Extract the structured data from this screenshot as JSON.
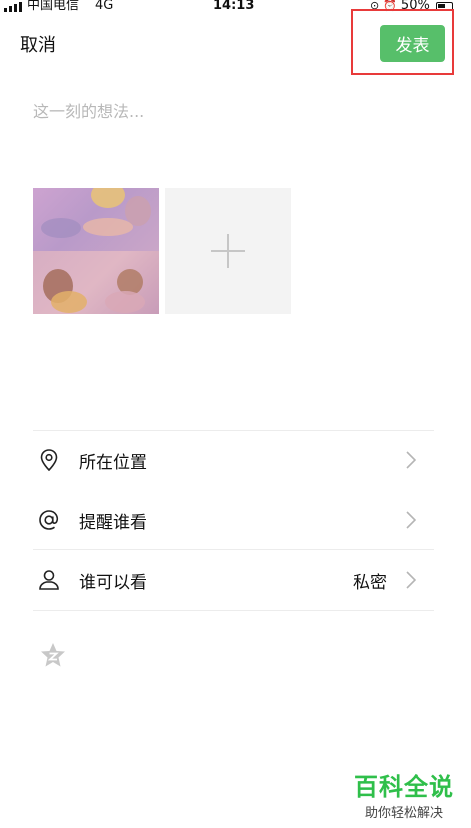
{
  "status_bar": {
    "carrier": "中国电信",
    "network": "4G",
    "time": "14:13",
    "battery": "50%"
  },
  "header": {
    "cancel_label": "取消",
    "publish_label": "发表"
  },
  "composer": {
    "placeholder": "这一刻的想法..."
  },
  "options": [
    {
      "label": "所在位置",
      "value": "",
      "icon": "location-icon"
    },
    {
      "label": "提醒谁看",
      "value": "",
      "icon": "at-icon"
    },
    {
      "label": "谁可以看",
      "value": "私密",
      "icon": "person-icon"
    }
  ],
  "watermark": {
    "title": "百科全说",
    "subtitle": "助你轻松解决"
  },
  "colors": {
    "accent": "#57bf6a",
    "highlight": "#e83a3a"
  }
}
